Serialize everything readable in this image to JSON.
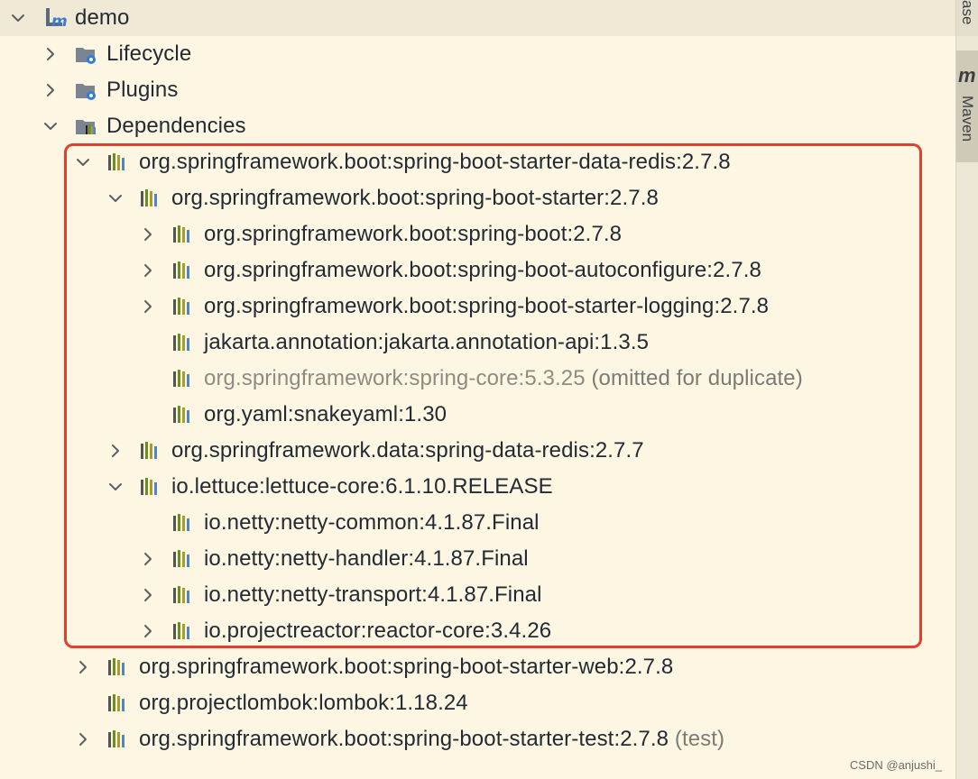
{
  "tree": {
    "rows": [
      {
        "label": "demo",
        "level": 0,
        "chevron": "down",
        "icon": "maven-module-icon",
        "kind": "root"
      },
      {
        "label": "Lifecycle",
        "level": 1,
        "chevron": "right",
        "icon": "folder-gear-icon"
      },
      {
        "label": "Plugins",
        "level": 1,
        "chevron": "right",
        "icon": "folder-gear-icon"
      },
      {
        "label": "Dependencies",
        "level": 1,
        "chevron": "down",
        "icon": "folder-library-icon"
      },
      {
        "label": "org.springframework.boot:spring-boot-starter-data-redis:2.7.8",
        "level": 2,
        "chevron": "down",
        "icon": "library-icon"
      },
      {
        "label": "org.springframework.boot:spring-boot-starter:2.7.8",
        "level": 3,
        "chevron": "down",
        "icon": "library-icon"
      },
      {
        "label": "org.springframework.boot:spring-boot:2.7.8",
        "level": 4,
        "chevron": "right",
        "icon": "library-icon"
      },
      {
        "label": "org.springframework.boot:spring-boot-autoconfigure:2.7.8",
        "level": 4,
        "chevron": "right",
        "icon": "library-icon"
      },
      {
        "label": "org.springframework.boot:spring-boot-starter-logging:2.7.8",
        "level": 4,
        "chevron": "right",
        "icon": "library-icon"
      },
      {
        "label": "jakarta.annotation:jakarta.annotation-api:1.3.5",
        "level": 4,
        "chevron": "none",
        "icon": "library-icon"
      },
      {
        "label": "org.springframework:spring-core:5.3.25",
        "level": 4,
        "chevron": "none",
        "icon": "library-icon",
        "faint": true,
        "note": "(omitted for duplicate)"
      },
      {
        "label": "org.yaml:snakeyaml:1.30",
        "level": 4,
        "chevron": "none",
        "icon": "library-icon"
      },
      {
        "label": "org.springframework.data:spring-data-redis:2.7.7",
        "level": 3,
        "chevron": "right",
        "icon": "library-icon"
      },
      {
        "label": "io.lettuce:lettuce-core:6.1.10.RELEASE",
        "level": 3,
        "chevron": "down",
        "icon": "library-icon"
      },
      {
        "label": "io.netty:netty-common:4.1.87.Final",
        "level": 4,
        "chevron": "none",
        "icon": "library-icon"
      },
      {
        "label": "io.netty:netty-handler:4.1.87.Final",
        "level": 4,
        "chevron": "right",
        "icon": "library-icon"
      },
      {
        "label": "io.netty:netty-transport:4.1.87.Final",
        "level": 4,
        "chevron": "right",
        "icon": "library-icon"
      },
      {
        "label": "io.projectreactor:reactor-core:3.4.26",
        "level": 4,
        "chevron": "right",
        "icon": "library-icon"
      },
      {
        "label": "org.springframework.boot:spring-boot-starter-web:2.7.8",
        "level": 2,
        "chevron": "right",
        "icon": "library-icon"
      },
      {
        "label": "org.projectlombok:lombok:1.18.24",
        "level": 2,
        "chevron": "none",
        "icon": "library-icon"
      },
      {
        "label": "org.springframework.boot:spring-boot-starter-test:2.7.8",
        "level": 2,
        "chevron": "right",
        "icon": "library-icon",
        "note": "(test)"
      }
    ]
  },
  "side_tabs": {
    "database_label": "ase",
    "maven_label": "Maven",
    "maven_glyph": "m"
  },
  "watermark": "CSDN @anjushi_",
  "colors": {
    "background": "#fdf6e3",
    "highlight_border": "#e0412f",
    "text": "#222b33",
    "faint_text": "#8c8c84",
    "library_bar_colors": [
      "#6b8e23",
      "#4a88c7",
      "#555555",
      "#a99f1f"
    ]
  }
}
